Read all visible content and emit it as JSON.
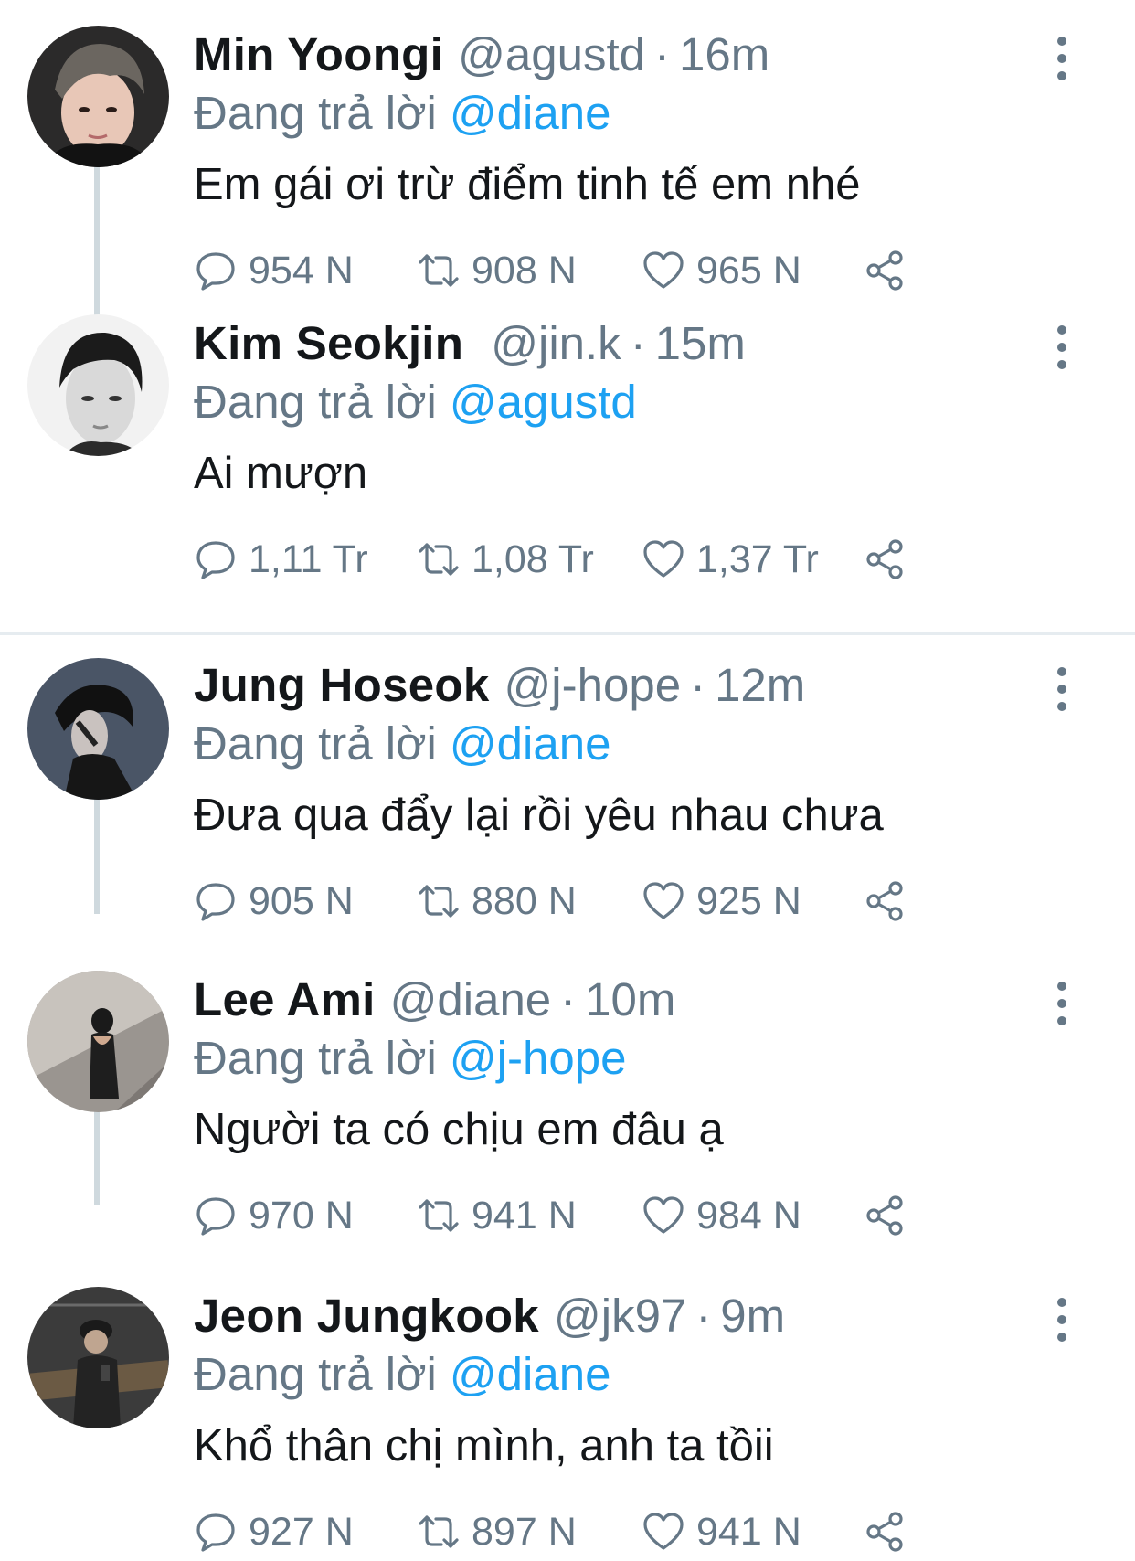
{
  "reply_prefix": "Đang trả lời",
  "separator": "·",
  "tweets": [
    {
      "name": "Min Yoongi",
      "handle": "@agustd",
      "time": "16m",
      "reply_to": "@diane",
      "text": "Em gái ơi trừ điểm tinh tế em nhé",
      "replies": "954 N",
      "retweets": "908 N",
      "likes": "965 N",
      "avatar_icon": "profile-photo"
    },
    {
      "name": "Kim Seokjin",
      "handle": "@jin.k",
      "time": "15m",
      "reply_to": "@agustd",
      "text": "Ai mượn",
      "replies": "1,11 Tr",
      "retweets": "1,08 Tr",
      "likes": "1,37 Tr",
      "avatar_icon": "profile-photo"
    },
    {
      "name": "Jung Hoseok",
      "handle": "@j-hope",
      "time": "12m",
      "reply_to": "@diane",
      "text": "Đưa qua đẩy lại rồi yêu nhau chưa",
      "replies": "905 N",
      "retweets": "880 N",
      "likes": "925 N",
      "avatar_icon": "profile-photo"
    },
    {
      "name": "Lee Ami",
      "handle": "@diane",
      "time": "10m",
      "reply_to": "@j-hope",
      "text": "Người ta có chịu em đâu ạ",
      "replies": "970 N",
      "retweets": "941 N",
      "likes": "984 N",
      "avatar_icon": "profile-photo"
    },
    {
      "name": "Jeon Jungkook",
      "handle": "@jk97",
      "time": "9m",
      "reply_to": "@diane",
      "text": "Khổ thân chị mình, anh ta tồii",
      "replies": "927 N",
      "retweets": "897 N",
      "likes": "941 N",
      "avatar_icon": "profile-photo"
    }
  ],
  "colors": {
    "text": "#14171a",
    "secondary": "#657786",
    "link": "#1da1f2",
    "thread_line": "#cfd9de",
    "divider": "#e6ecf0"
  },
  "icons": {
    "reply": "speech-bubble-icon",
    "retweet": "retweet-arrows-icon",
    "like": "heart-outline-icon",
    "share": "share-nodes-icon",
    "more": "vertical-dots-icon"
  }
}
